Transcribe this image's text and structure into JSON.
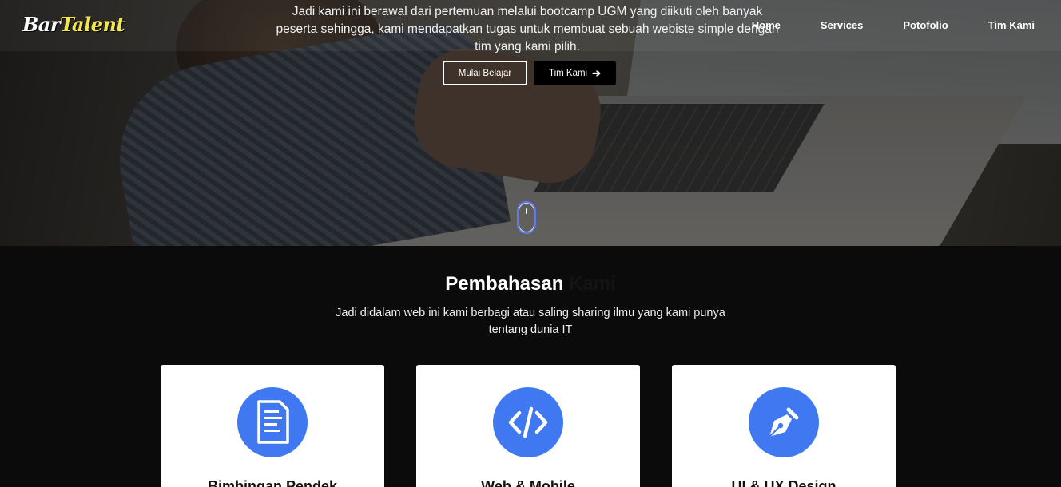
{
  "navbar": {
    "logo_first": "Bar",
    "logo_second": "Talent",
    "links": [
      "Home",
      "Services",
      "Potofolio",
      "Tim Kami"
    ]
  },
  "hero": {
    "text": "Jadi kami ini berawal dari pertemuan melalui bootcamp UGM yang diikuti oleh banyak peserta sehingga, kami mendapatkan tugas untuk membuat sebuah webiste simple dengan tim yang kami pilih.",
    "primary_button": "Mulai Belajar",
    "secondary_button": "Tim Kami",
    "secondary_icon": "arrow-right-icon",
    "scroll_icon": "mouse-scroll-icon"
  },
  "section": {
    "title_main": "Pembahasan",
    "title_accent": "Kami",
    "description": "Jadi didalam web ini kami berbagi atau saling sharing ilmu yang kami punya tentang dunia IT",
    "accent_color": "#3f78f0",
    "cards": [
      {
        "icon": "document-icon",
        "title": "Bimbingan Pendek"
      },
      {
        "icon": "code-icon",
        "title": "Web & Mobile"
      },
      {
        "icon": "pen-icon",
        "title": "UI & UX Design"
      }
    ]
  }
}
